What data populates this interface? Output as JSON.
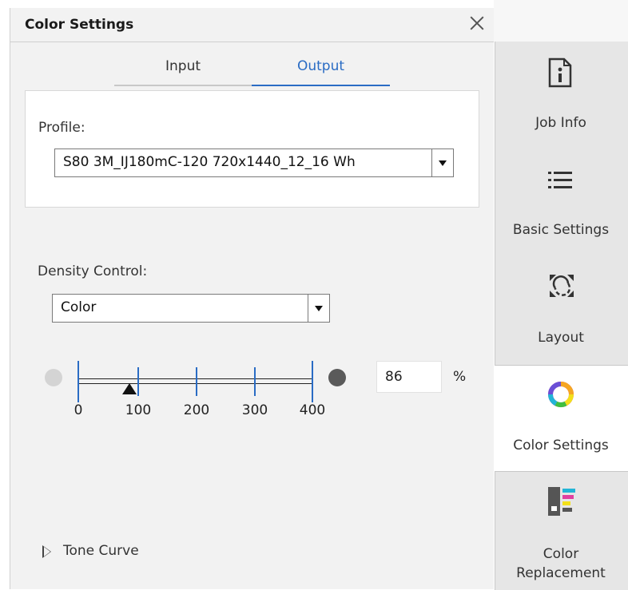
{
  "panel": {
    "title": "Color Settings"
  },
  "tabs": [
    {
      "label": "Input",
      "active": false
    },
    {
      "label": "Output",
      "active": true
    }
  ],
  "profile": {
    "label": "Profile:",
    "value": "S80 3M_IJ180mC-120 720x1440_12_16 Wh"
  },
  "density": {
    "label": "Density Control:",
    "mode": "Color",
    "scale_labels": [
      "0",
      "100",
      "200",
      "300",
      "400"
    ],
    "value": "86",
    "unit": "%"
  },
  "tone_curve": {
    "label": "Tone Curve",
    "expanded": false
  },
  "sidebar": {
    "items": [
      {
        "label": "Job Info",
        "icon": "job-info-icon"
      },
      {
        "label": "Basic Settings",
        "icon": "list-icon"
      },
      {
        "label": "Layout",
        "icon": "layout-icon"
      },
      {
        "label": "Color Settings",
        "icon": "color-wheel-icon",
        "active": true
      },
      {
        "label": "Color\nReplacement",
        "icon": "color-replacement-icon"
      }
    ]
  },
  "colors": {
    "accent": "#2a6cc4",
    "panel_bg": "#f2f2f2",
    "sidebar_bg": "#e6e6e6"
  }
}
